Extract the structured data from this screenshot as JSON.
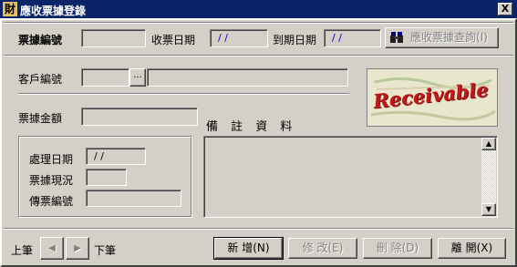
{
  "window": {
    "title": "應收票據登錄",
    "title_icon": "財",
    "close_glyph": "X"
  },
  "form": {
    "note_no_label": "票據編號",
    "receive_date_label": "收票日期",
    "receive_date_value": "/ /",
    "due_date_label": "到期日期",
    "due_date_value": "/ /",
    "query_button": "應收票據查詢(I)",
    "customer_no_label": "客戶編號",
    "lookup_button": "...",
    "amount_label": "票據金額",
    "remarks_label": "備 註 資 料",
    "logo_text": "Receivable",
    "process_date_label": "處理日期",
    "process_date_value": "/ /",
    "note_status_label": "票據現況",
    "voucher_no_label": "傳票編號"
  },
  "nav": {
    "prev_label": "上筆",
    "next_label": "下筆",
    "prev_icon": "◀",
    "next_icon": "▶"
  },
  "actions": {
    "add": "新 增(N)",
    "edit": "修 改(E)",
    "delete": "刪 除(D)",
    "exit": "離 開(X)"
  },
  "scroll": {
    "up": "▲",
    "down": "▼"
  },
  "colors": {
    "titlebar": "#0a246a",
    "date_text": "#0000c0",
    "logo_text": "#c01818",
    "face": "#d4d0c8"
  }
}
